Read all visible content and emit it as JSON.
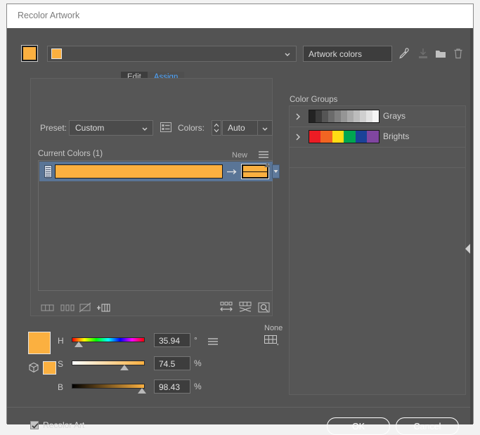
{
  "window": {
    "title": "Recolor Artwork"
  },
  "toolbar": {
    "color_group_name": "Artwork colors",
    "icons": [
      {
        "name": "eyedropper-icon"
      },
      {
        "name": "save-color-group-icon"
      },
      {
        "name": "new-color-group-icon"
      },
      {
        "name": "delete-color-group-icon"
      }
    ]
  },
  "tabs": [
    {
      "label": "Edit",
      "active": false
    },
    {
      "label": "Assign",
      "active": true
    }
  ],
  "assign": {
    "preset_label": "Preset:",
    "preset_value": "Custom",
    "colors_label": "Colors:",
    "colors_value": "Auto",
    "current_colors_label": "Current Colors (1)",
    "new_label": "New",
    "rows": [
      {
        "current_color": "#fbb040",
        "new_color": "#fbb040"
      }
    ],
    "bottom_icons_left": [
      {
        "name": "grouped-columns-icon"
      },
      {
        "name": "separated-columns-icon"
      },
      {
        "name": "exclude-colors-icon"
      },
      {
        "name": "add-color-row-icon"
      }
    ],
    "bottom_icons_right": [
      {
        "name": "randomize-color-order-icon"
      },
      {
        "name": "randomize-saturation-brightness-icon"
      },
      {
        "name": "color-preview-icon"
      }
    ]
  },
  "color_groups": {
    "heading": "Color Groups",
    "items": [
      {
        "name": "Grays",
        "swatches": [
          "#232323",
          "#3b3b3b",
          "#555555",
          "#6b6b6b",
          "#7f7f7f",
          "#959595",
          "#a9a9a9",
          "#bcbcbc",
          "#cfcfcf",
          "#e2e2e2",
          "#f5f5f5"
        ]
      },
      {
        "name": "Brights",
        "swatches": [
          "#ec1c24",
          "#f26522",
          "#ffdd15",
          "#00a651",
          "#1b4298",
          "#8046a0"
        ]
      }
    ]
  },
  "color_editor": {
    "preview_color": "#fbb040",
    "none_label": "None",
    "channels": [
      {
        "label": "H",
        "value": "35.94",
        "unit": "°",
        "position": 10
      },
      {
        "label": "S",
        "value": "74.5",
        "unit": "%",
        "position": 72
      },
      {
        "label": "B",
        "value": "98.43",
        "unit": "%",
        "position": 96
      }
    ]
  },
  "footer": {
    "recolor_art_label": "Recolor Art",
    "recolor_art_checked": true,
    "ok_label": "OK",
    "cancel_label": "Cancel"
  }
}
